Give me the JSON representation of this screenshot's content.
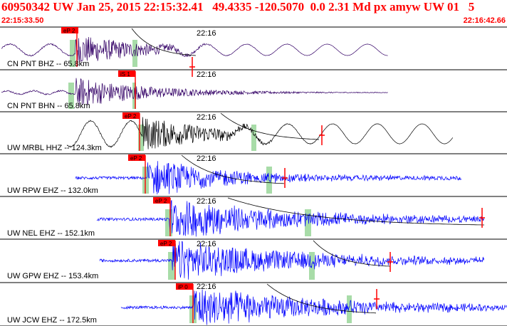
{
  "header": {
    "title": "60950342 UW Jan 25, 2015 22:15:32.41   49.4335 -120.5070  0.0 2.31 Md px amyw UW 01   5",
    "start_time": "22:15:33.50",
    "end_time": "22:16:42.66"
  },
  "colors": {
    "header_text": "#ff0000",
    "pick": "#ff0000",
    "window": "#a8dca8",
    "coda": "#000000",
    "trace_purple": "#330066",
    "trace_black": "#000000",
    "trace_blue": "#0000ff"
  },
  "traces": [
    {
      "label": "CN PNT BHZ -- 65.8km",
      "time_mark": "22:16",
      "pick": "eP 2",
      "color": "purple"
    },
    {
      "label": "CN PNT BHN -- 65.8km",
      "time_mark": "22:16",
      "pick": "iS 1",
      "color": "purple"
    },
    {
      "label": "UW MRBL HHZ -- 124.3km",
      "time_mark": "22:16",
      "pick": "eP 2",
      "color": "black"
    },
    {
      "label": "UW RPW EHZ -- 132.0km",
      "time_mark": "22:16",
      "pick": "eP 2",
      "color": "blue"
    },
    {
      "label": "UW NEL EHZ -- 152.1km",
      "time_mark": "22:16",
      "pick": "eP 2",
      "color": "blue"
    },
    {
      "label": "UW GPW EHZ -- 153.4km",
      "time_mark": "22:16",
      "pick": "eP 2",
      "color": "blue"
    },
    {
      "label": "UW JCW EHZ -- 172.5km",
      "time_mark": "22:16",
      "pick": "iP 0",
      "color": "blue"
    }
  ]
}
